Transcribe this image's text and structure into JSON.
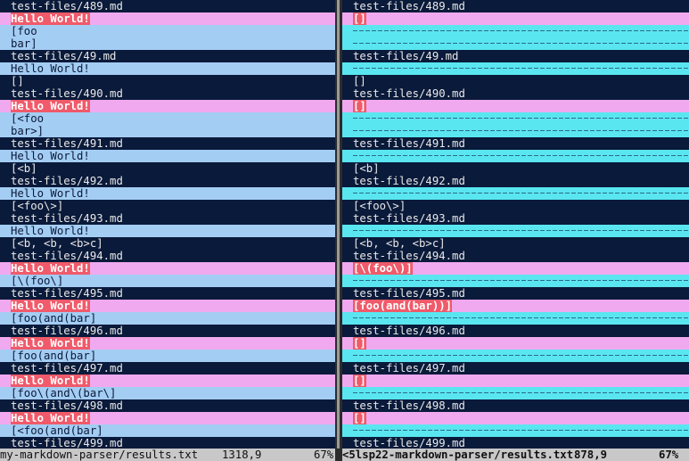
{
  "left_pane": {
    "lines": [
      {
        "text": "test-files/489.md",
        "style": "navy"
      },
      {
        "text": "Hello World!",
        "style": "pink-hl"
      },
      {
        "text": "[foo",
        "style": "blue"
      },
      {
        "text": "bar]",
        "style": "blue"
      },
      {
        "text": "test-files/49.md",
        "style": "navy"
      },
      {
        "text": "Hello World!",
        "style": "blue"
      },
      {
        "text": "[]",
        "style": "navy"
      },
      {
        "text": "test-files/490.md",
        "style": "navy"
      },
      {
        "text": "Hello World!",
        "style": "pink-hl"
      },
      {
        "text": "[<foo",
        "style": "blue"
      },
      {
        "text": "bar>]",
        "style": "blue"
      },
      {
        "text": "test-files/491.md",
        "style": "navy"
      },
      {
        "text": "Hello World!",
        "style": "blue"
      },
      {
        "text": "[<b]",
        "style": "navy"
      },
      {
        "text": "test-files/492.md",
        "style": "navy"
      },
      {
        "text": "Hello World!",
        "style": "blue"
      },
      {
        "text": "[<foo\\>]",
        "style": "navy"
      },
      {
        "text": "test-files/493.md",
        "style": "navy"
      },
      {
        "text": "Hello World!",
        "style": "blue"
      },
      {
        "text": "[<b, <b, <b>c]",
        "style": "navy"
      },
      {
        "text": "test-files/494.md",
        "style": "navy"
      },
      {
        "text": "Hello World!",
        "style": "pink-hl"
      },
      {
        "text": "[\\(foo\\]",
        "style": "blue"
      },
      {
        "text": "test-files/495.md",
        "style": "navy"
      },
      {
        "text": "Hello World!",
        "style": "pink-hl"
      },
      {
        "text": "[foo(and(bar]",
        "style": "blue"
      },
      {
        "text": "test-files/496.md",
        "style": "navy"
      },
      {
        "text": "Hello World!",
        "style": "pink-hl"
      },
      {
        "text": "[foo(and(bar]",
        "style": "blue"
      },
      {
        "text": "test-files/497.md",
        "style": "navy"
      },
      {
        "text": "Hello World!",
        "style": "pink-hl"
      },
      {
        "text": "[foo\\(and\\(bar\\]",
        "style": "blue"
      },
      {
        "text": "test-files/498.md",
        "style": "navy"
      },
      {
        "text": "Hello World!",
        "style": "pink-hl"
      },
      {
        "text": "[<foo(and(bar]",
        "style": "blue"
      },
      {
        "text": "test-files/499.md",
        "style": "navy"
      }
    ]
  },
  "right_pane": {
    "lines": [
      {
        "text": "test-files/489.md",
        "style": "navy"
      },
      {
        "text": "[]",
        "style": "pink-hl"
      },
      {
        "text": "",
        "style": "dash"
      },
      {
        "text": "",
        "style": "dash"
      },
      {
        "text": "test-files/49.md",
        "style": "navy"
      },
      {
        "text": "",
        "style": "dash"
      },
      {
        "text": "[]",
        "style": "navy"
      },
      {
        "text": "test-files/490.md",
        "style": "navy"
      },
      {
        "text": "[]",
        "style": "pink-hl"
      },
      {
        "text": "",
        "style": "dash"
      },
      {
        "text": "",
        "style": "dash"
      },
      {
        "text": "test-files/491.md",
        "style": "navy"
      },
      {
        "text": "",
        "style": "dash"
      },
      {
        "text": "[<b]",
        "style": "navy"
      },
      {
        "text": "test-files/492.md",
        "style": "navy"
      },
      {
        "text": "",
        "style": "dash"
      },
      {
        "text": "[<foo\\>]",
        "style": "navy"
      },
      {
        "text": "test-files/493.md",
        "style": "navy"
      },
      {
        "text": "",
        "style": "dash"
      },
      {
        "text": "[<b, <b, <b>c]",
        "style": "navy"
      },
      {
        "text": "test-files/494.md",
        "style": "navy"
      },
      {
        "text": "[\\(foo\\)]",
        "style": "pink-hl-inner"
      },
      {
        "text": "",
        "style": "dash"
      },
      {
        "text": "test-files/495.md",
        "style": "navy"
      },
      {
        "text": "[foo(and(bar))]",
        "style": "pink-hl"
      },
      {
        "text": "",
        "style": "dash"
      },
      {
        "text": "test-files/496.md",
        "style": "navy"
      },
      {
        "text": "[]",
        "style": "pink-hl"
      },
      {
        "text": "",
        "style": "dash"
      },
      {
        "text": "test-files/497.md",
        "style": "navy"
      },
      {
        "text": "[]",
        "style": "pink-hl"
      },
      {
        "text": "",
        "style": "dash"
      },
      {
        "text": "test-files/498.md",
        "style": "navy"
      },
      {
        "text": "[]",
        "style": "pink-hl"
      },
      {
        "text": "",
        "style": "dash"
      },
      {
        "text": "test-files/499.md",
        "style": "navy"
      }
    ]
  },
  "status_bar": {
    "left_file": "my-markdown-parser/results.txt",
    "left_position": "1318,9",
    "left_percent": "67%",
    "right_file": "<5lsp22-markdown-parser/results.txt",
    "right_position": "878,9",
    "right_percent": "67%"
  },
  "colors": {
    "background": "#0a1a3a",
    "text_line": "#a4cdf3",
    "changed_line": "#f0a9ef",
    "filler_line": "#5ae6f0",
    "changed_text": "#f05a6a"
  }
}
